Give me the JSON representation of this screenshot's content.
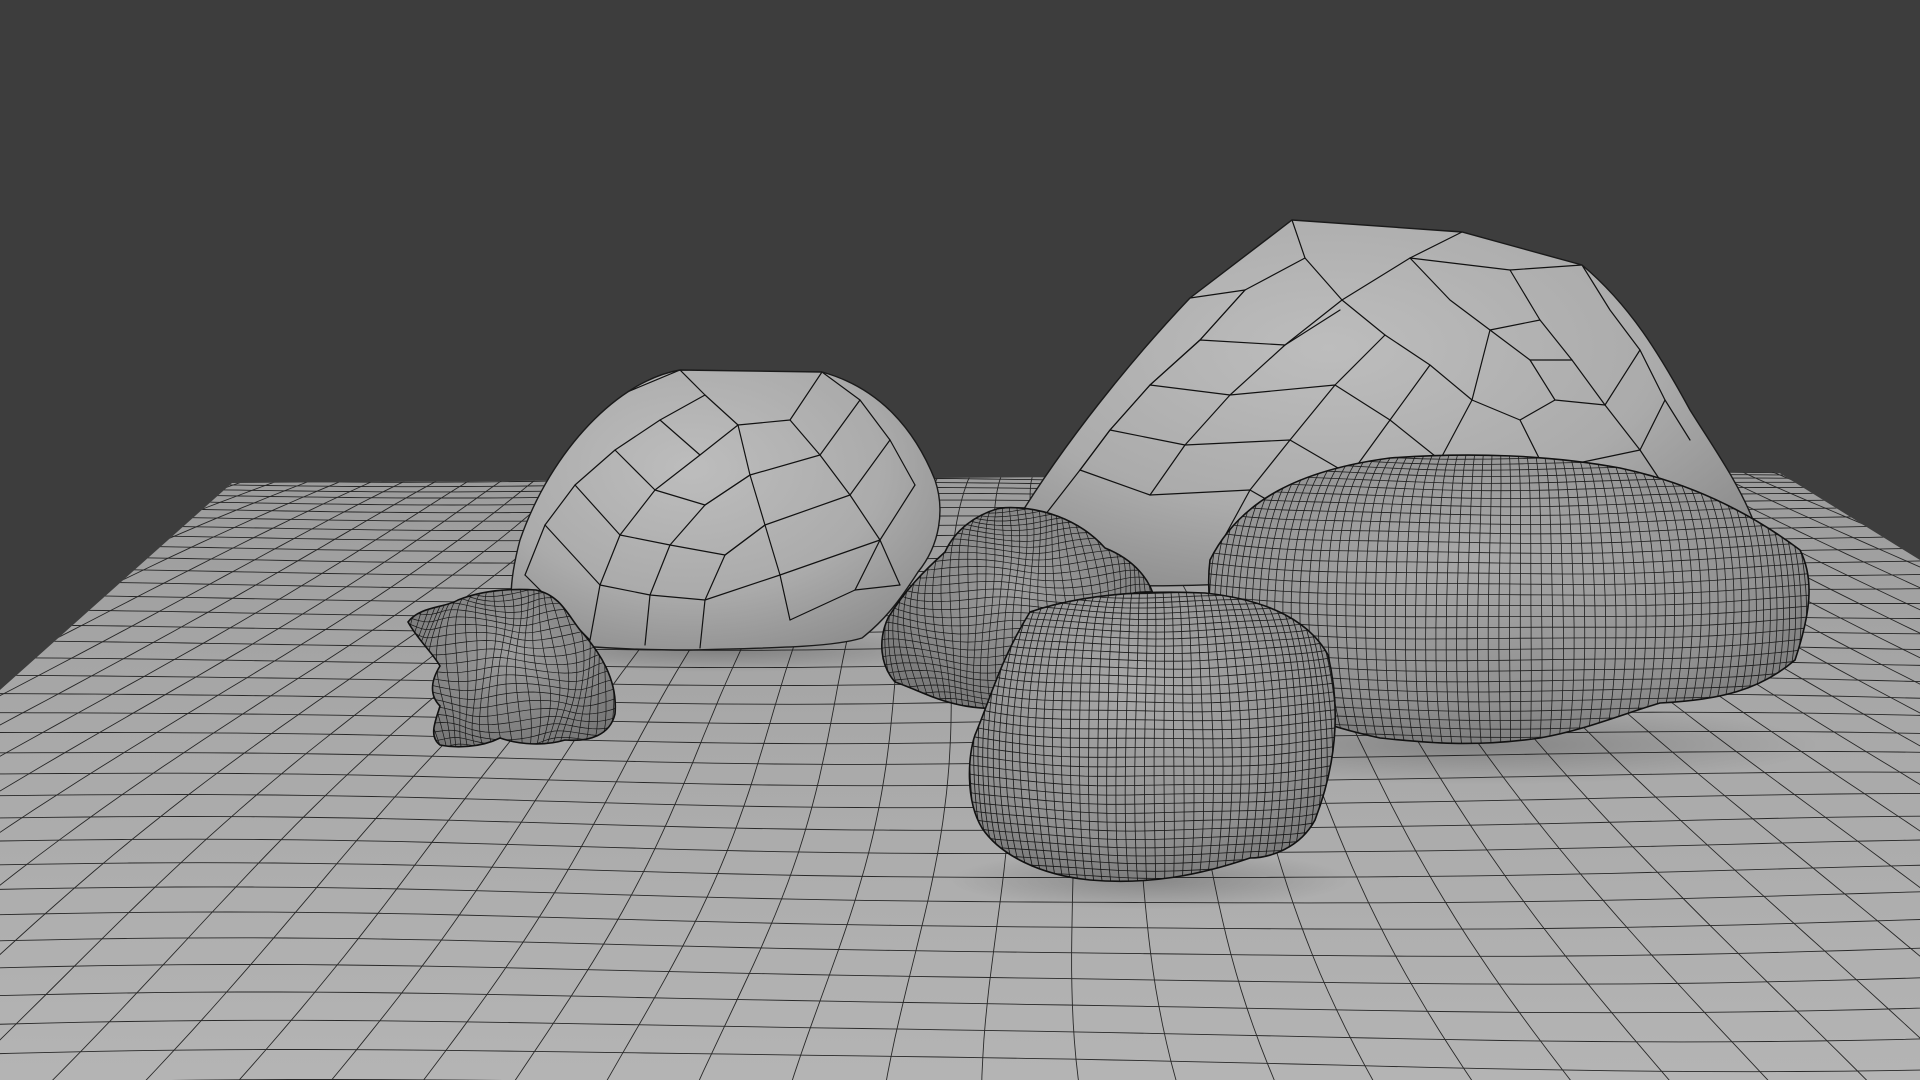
{
  "viewport": {
    "background_color": "#3d3d3d",
    "surface_color": "#a6a6a6",
    "wire_color": "#111111",
    "shading": "solid",
    "overlay": "wireframe"
  },
  "scene": {
    "objects": [
      {
        "name": "ground-plane",
        "kind": "displaced grid plane"
      },
      {
        "name": "small-crumpled-rock",
        "kind": "sculpted rock, dense mesh"
      },
      {
        "name": "medium-low-poly-rock",
        "kind": "low-poly rock"
      },
      {
        "name": "large-low-poly-rock",
        "kind": "low-poly rock"
      },
      {
        "name": "elongated-dense-rock",
        "kind": "high-resolution rock"
      },
      {
        "name": "lumpy-dense-rock",
        "kind": "sculpted rock, dense mesh"
      },
      {
        "name": "front-rounded-dense-rock",
        "kind": "high-resolution rock"
      }
    ]
  }
}
